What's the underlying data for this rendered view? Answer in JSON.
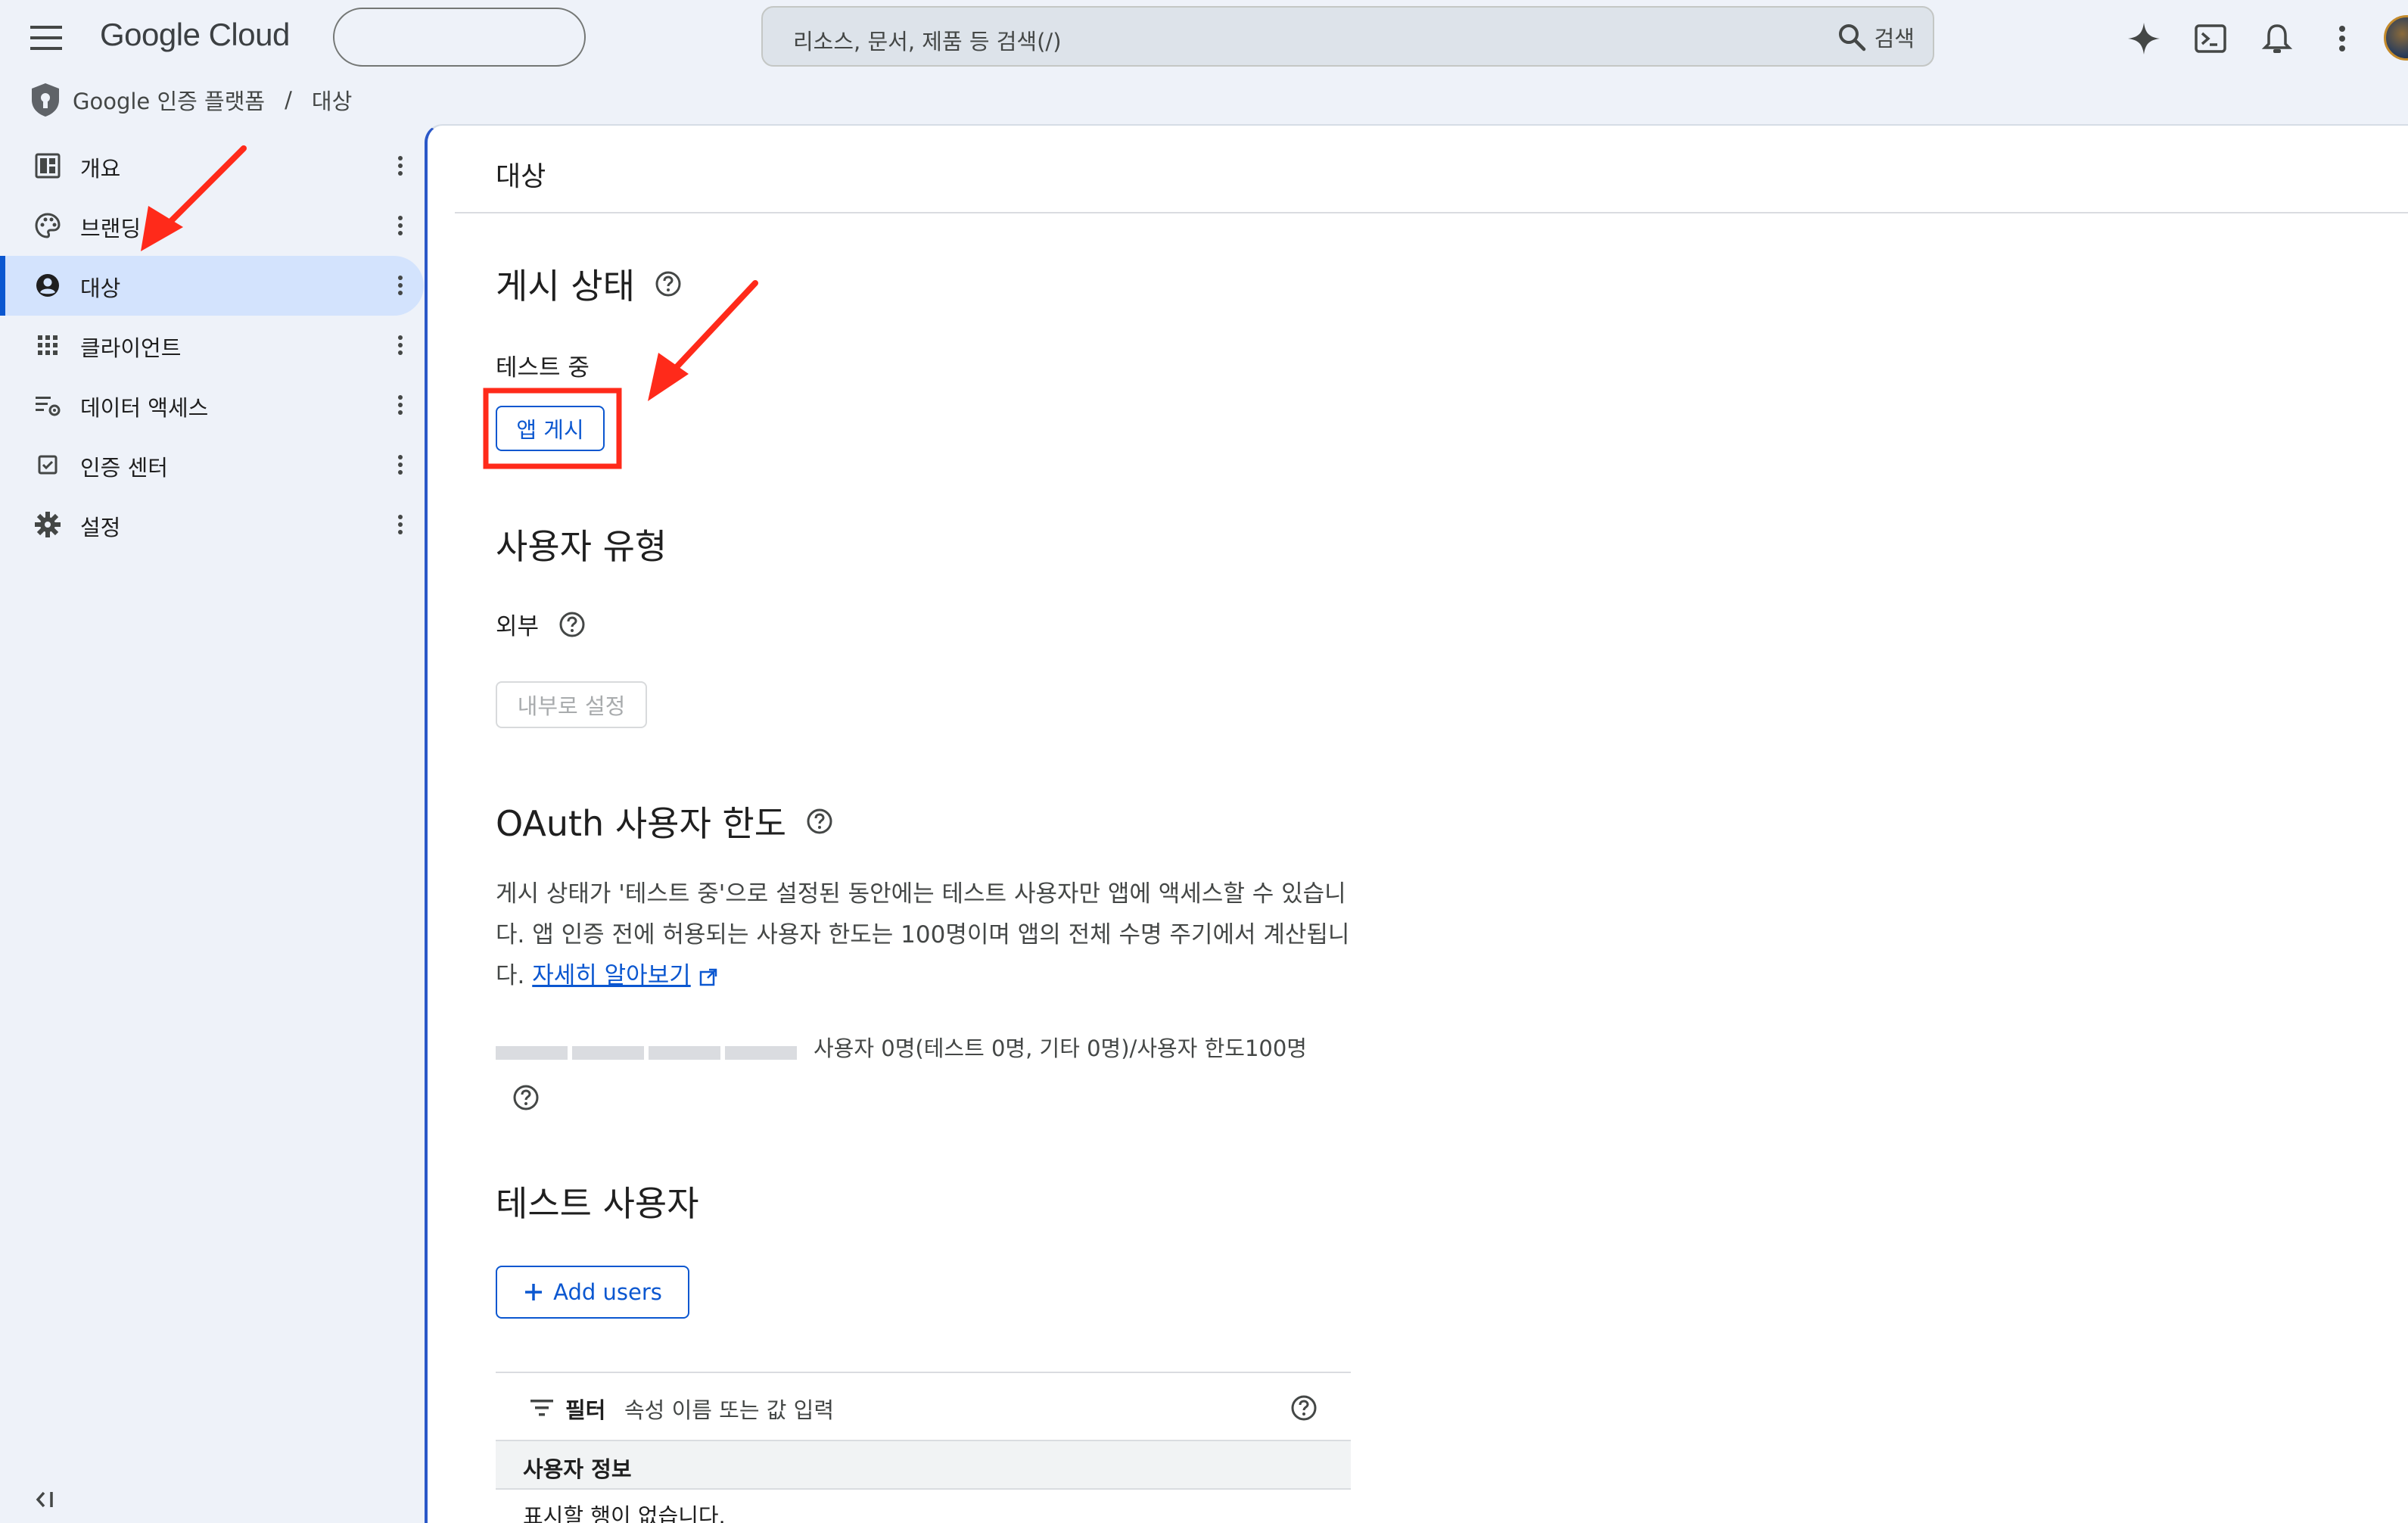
{
  "app": {
    "logo_text": "Google Cloud",
    "search_placeholder": "리소스, 문서, 제품 등 검색(/)",
    "search_button": "검색"
  },
  "breadcrumb": {
    "product": "Google 인증 플랫폼",
    "separator": "/",
    "current": "대상"
  },
  "sidebar": {
    "items": [
      {
        "label": "개요",
        "icon": "dashboard-icon"
      },
      {
        "label": "브랜딩",
        "icon": "palette-icon"
      },
      {
        "label": "대상",
        "icon": "account-circle-icon",
        "active": true
      },
      {
        "label": "클라이언트",
        "icon": "apps-grid-icon"
      },
      {
        "label": "데이터 액세스",
        "icon": "data-access-icon"
      },
      {
        "label": "인증 센터",
        "icon": "verified-checkbox-icon"
      },
      {
        "label": "설정",
        "icon": "gear-icon"
      }
    ]
  },
  "main": {
    "page_title": "대상",
    "publish_status": {
      "heading": "게시 상태",
      "status": "테스트 중",
      "publish_button": "앱 게시"
    },
    "user_type": {
      "heading": "사용자 유형",
      "value": "외부",
      "make_internal_button": "내부로 설정"
    },
    "oauth_limit": {
      "heading": "OAuth 사용자 한도",
      "description": "게시 상태가 '테스트 중'으로 설정된 동안에는 테스트 사용자만 앱에 액세스할 수 있습니다. 앱 인증 전에 허용되는 사용자 한도는 100명이며 앱의 전체 수명 주기에서 계산됩니다.",
      "learn_more": "자세히 알아보기",
      "usage_text": "사용자 0명(테스트 0명, 기타 0명)/사용자 한도100명",
      "usage_fraction": 0
    },
    "test_users": {
      "heading": "테스트 사용자",
      "add_button": "Add users",
      "filter_label": "필터",
      "filter_placeholder": "속성 이름 또는 값 입력",
      "column_header": "사용자 정보",
      "empty_text": "표시할 행이 없습니다."
    }
  },
  "colors": {
    "accent": "#0b57d0",
    "active_nav_bg": "#d3e3fd",
    "annotation": "#ff2a1a"
  }
}
